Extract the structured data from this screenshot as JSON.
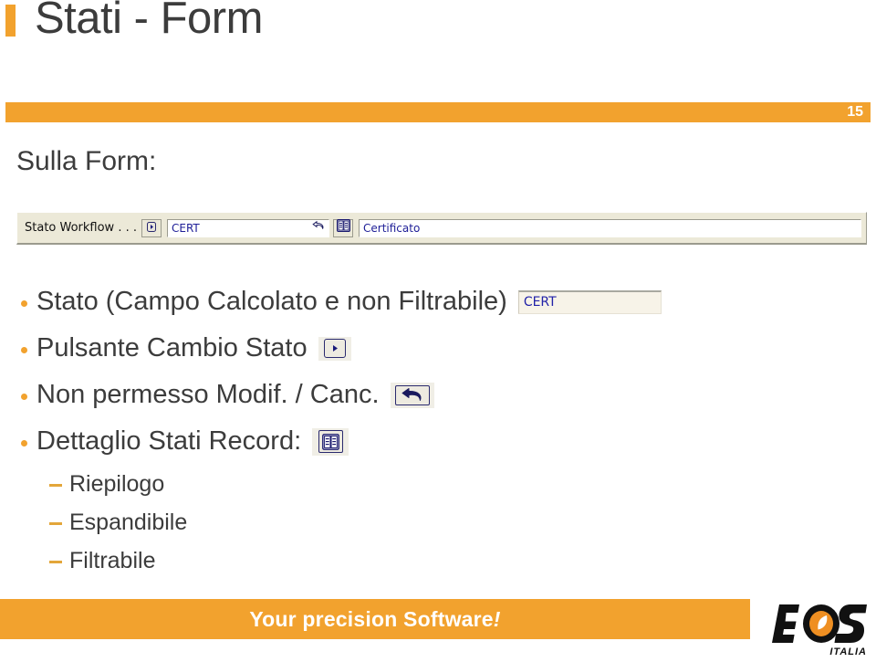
{
  "slide": {
    "title": "Stati - Form",
    "page_number": "15",
    "sub_heading": "Sulla Form:",
    "accent_color": "#f2a22e",
    "text_color": "#3c3c3c"
  },
  "form_toolbar": {
    "label": "Stato Workflow . . .",
    "change_state_icon": "play-triangle-icon",
    "state_value": "CERT",
    "undo_icon": "undo-arrow-icon",
    "detail_icon": "table-grid-icon",
    "description_value": "Certificato"
  },
  "bullets": [
    {
      "text": "Stato (Campo Calcolato e non Filtrabile)",
      "widget": "cert-field",
      "widget_value": "CERT"
    },
    {
      "text": "Pulsante Cambio Stato",
      "widget": "play-button",
      "widget_value": ""
    },
    {
      "text": "Non permesso Modif. / Canc.",
      "widget": "undo-button",
      "widget_value": ""
    },
    {
      "text": "Dettaglio Stati Record:",
      "widget": "grid-button",
      "widget_value": ""
    }
  ],
  "sub_bullets": [
    {
      "text": "Riepilogo"
    },
    {
      "text": "Espandibile"
    },
    {
      "text": "Filtrabile"
    }
  ],
  "footer": {
    "tagline_main": "Your precision Software",
    "tagline_excl": "!",
    "logo_text": "EOS",
    "logo_sub": "ITALIA",
    "bar_color": "#f2a22e"
  }
}
